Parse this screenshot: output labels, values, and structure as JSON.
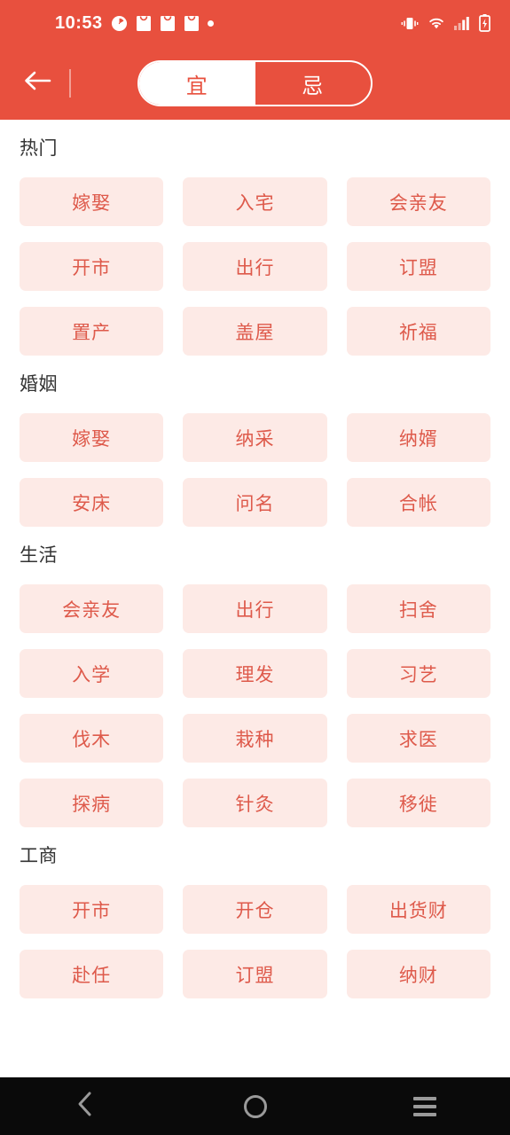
{
  "statusbar": {
    "time": "10:53",
    "left_icons": [
      "alarm-clock-icon",
      "notification-bag-icon",
      "notification-bag-icon",
      "notification-bag-icon",
      "notification-dot-icon"
    ],
    "right_icons": [
      "vibrate-icon",
      "wifi-icon",
      "signal-bars-icon",
      "battery-charging-icon"
    ]
  },
  "appbar": {
    "back_icon": "back-arrow-icon",
    "toggle": {
      "options": [
        "宜",
        "忌"
      ],
      "selected": "宜"
    }
  },
  "colors": {
    "brand_red": "#E8503E",
    "chip_bg": "#FDEAE6",
    "chip_text": "#DE5A4B",
    "section_title": "#333333"
  },
  "sections": [
    {
      "title": "热门",
      "chips": [
        "嫁娶",
        "入宅",
        "会亲友",
        "开市",
        "出行",
        "订盟",
        "置产",
        "盖屋",
        "祈福"
      ]
    },
    {
      "title": "婚姻",
      "chips": [
        "嫁娶",
        "纳采",
        "纳婿",
        "安床",
        "问名",
        "合帐"
      ]
    },
    {
      "title": "生活",
      "chips": [
        "会亲友",
        "出行",
        "扫舍",
        "入学",
        "理发",
        "习艺",
        "伐木",
        "栽种",
        "求医",
        "探病",
        "针灸",
        "移徙"
      ]
    },
    {
      "title": "工商",
      "chips": [
        "开市",
        "开仓",
        "出货财",
        "赴任",
        "订盟",
        "纳财"
      ]
    }
  ],
  "navbar": {
    "back_label": "back-chevron-icon",
    "home_label": "home-circle-icon",
    "recents_label": "recents-menu-icon"
  }
}
